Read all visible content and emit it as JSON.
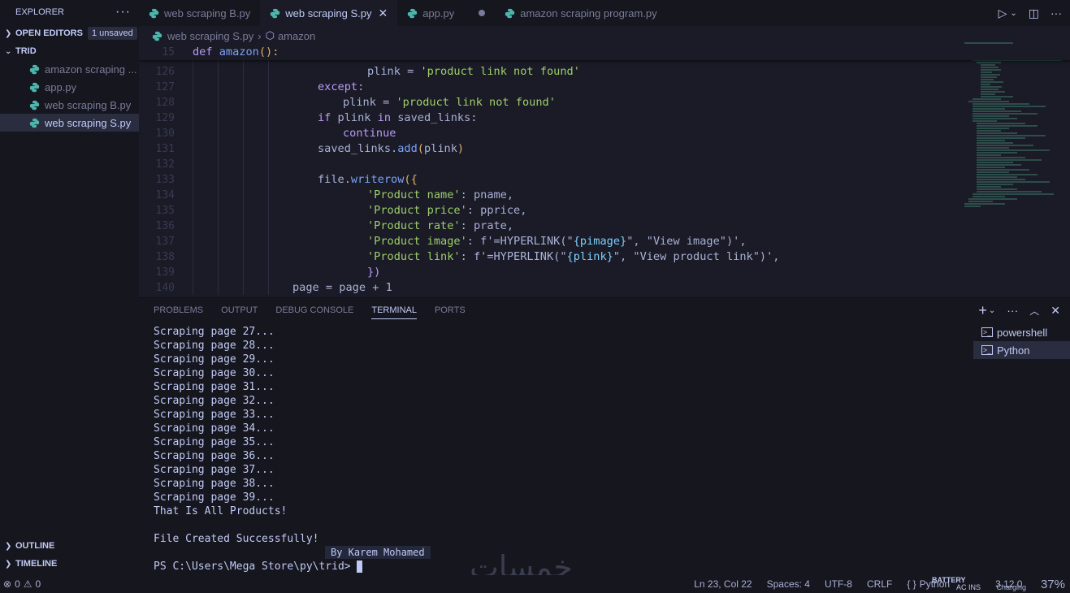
{
  "sidebar": {
    "title": "EXPLORER",
    "open_editors": {
      "label": "OPEN EDITORS",
      "badge": "1 unsaved"
    },
    "folder": {
      "label": "TRID"
    },
    "files": [
      {
        "name": "amazon scraping ...",
        "active": false
      },
      {
        "name": "app.py",
        "active": false
      },
      {
        "name": "web scraping B.py",
        "active": false
      },
      {
        "name": "web scraping S.py",
        "active": true
      }
    ],
    "outline": "OUTLINE",
    "timeline": "TIMELINE"
  },
  "tabs": [
    {
      "label": "web scraping B.py",
      "active": false
    },
    {
      "label": "web scraping S.py",
      "active": true
    },
    {
      "label": "app.py",
      "active": false,
      "dirty": true
    },
    {
      "label": "amazon scraping program.py",
      "active": false
    }
  ],
  "breadcrumb": {
    "file": "web scraping S.py",
    "symbol": "amazon"
  },
  "editor": {
    "sticky": {
      "line": "15",
      "code": "def amazon():"
    },
    "line_numbers": [
      "126",
      "127",
      "128",
      "129",
      "130",
      "131",
      "132",
      "133",
      "134",
      "135",
      "136",
      "137",
      "138",
      "139",
      "140"
    ],
    "lines": {
      "l126": "plink = ",
      "l126s": "'product link not found'",
      "l127": "except:",
      "l128a": "plink = ",
      "l128s": "'product link not found'",
      "l129a": "if",
      "l129b": " plink ",
      "l129c": "in",
      "l129d": " saved_links:",
      "l130": "continue",
      "l131a": "saved_links.",
      "l131b": "add",
      "l131c": "(",
      "l131d": "plink",
      "l131e": ")",
      "l133a": "file.",
      "l133b": "writerow",
      "l133c": "({",
      "l134k": "'Product name'",
      "l134v": ": pname,",
      "l135k": "'Product price'",
      "l135v": ": pprice,",
      "l136k": "'Product rate'",
      "l136v": ": prate,",
      "l137k": "'Product image'",
      "l137a": ": f'=HYPERLINK(\"",
      "l137i": "{pimage}",
      "l137b": "\", \"View image\")',",
      "l138k": "'Product link'",
      "l138a": ": f'=HYPERLINK(\"",
      "l138i": "{plink}",
      "l138b": "\", \"View product link\")',",
      "l139": "})",
      "l140": "page = page + 1"
    }
  },
  "panel": {
    "tabs": [
      "PROBLEMS",
      "OUTPUT",
      "DEBUG CONSOLE",
      "TERMINAL",
      "PORTS"
    ],
    "active_tab": "TERMINAL",
    "terminal_lines": [
      "Scraping page 27...",
      "Scraping page 28...",
      "Scraping page 29...",
      "Scraping page 30...",
      "Scraping page 31...",
      "Scraping page 32...",
      "Scraping page 33...",
      "Scraping page 34...",
      "Scraping page 35...",
      "Scraping page 36...",
      "Scraping page 37...",
      "Scraping page 38...",
      "Scraping page 39...",
      "That Is All Products!",
      "",
      "File Created Successfully!",
      "",
      "PS C:\\Users\\Mega Store\\py\\trid> "
    ],
    "tooltip": "By Karem Mohamed",
    "shells": [
      {
        "name": "powershell",
        "active": false
      },
      {
        "name": "Python",
        "active": true
      }
    ],
    "watermark": "خمسات"
  },
  "statusbar": {
    "errors": "0",
    "warnings": "0",
    "position": "Ln 23, Col 22",
    "spaces": "Spaces: 4",
    "encoding": "UTF-8",
    "eol": "CRLF",
    "language_braces": "{ }",
    "language": "Python",
    "version": "3.12.0",
    "battery_label": "BATTERY",
    "battery_sub": "AC INS",
    "charging": "Charging",
    "percent": "37%"
  }
}
